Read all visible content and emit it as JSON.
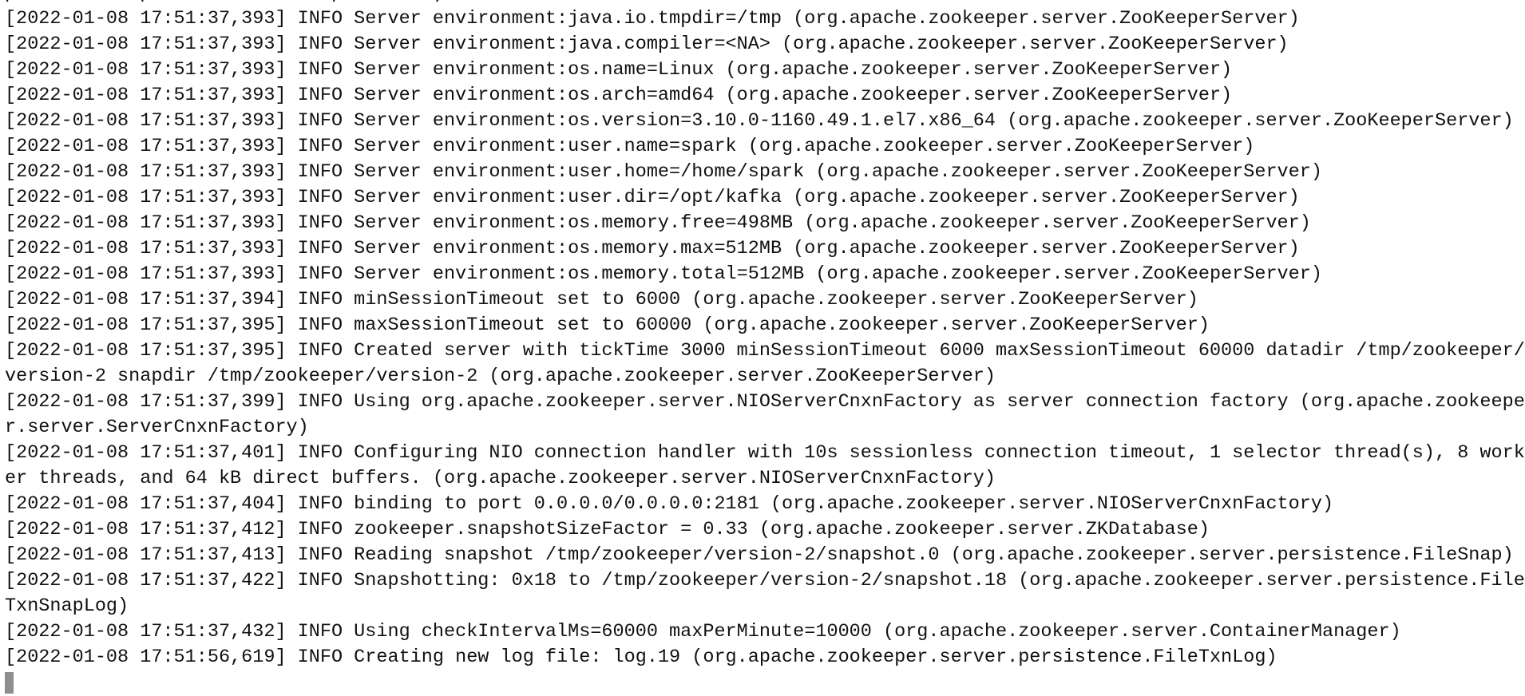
{
  "terminal": {
    "rows": [
      "pache.zookeeper.server.ZooKeeperServer)",
      "[2022-01-08 17:51:37,393] INFO Server environment:java.io.tmpdir=/tmp (org.apache.zookeeper.server.ZooKeeperServer)",
      "[2022-01-08 17:51:37,393] INFO Server environment:java.compiler=<NA> (org.apache.zookeeper.server.ZooKeeperServer)",
      "[2022-01-08 17:51:37,393] INFO Server environment:os.name=Linux (org.apache.zookeeper.server.ZooKeeperServer)",
      "[2022-01-08 17:51:37,393] INFO Server environment:os.arch=amd64 (org.apache.zookeeper.server.ZooKeeperServer)",
      "[2022-01-08 17:51:37,393] INFO Server environment:os.version=3.10.0-1160.49.1.el7.x86_64 (org.apache.zookeeper.server.ZooKeeperServer)",
      "[2022-01-08 17:51:37,393] INFO Server environment:user.name=spark (org.apache.zookeeper.server.ZooKeeperServer)",
      "[2022-01-08 17:51:37,393] INFO Server environment:user.home=/home/spark (org.apache.zookeeper.server.ZooKeeperServer)",
      "[2022-01-08 17:51:37,393] INFO Server environment:user.dir=/opt/kafka (org.apache.zookeeper.server.ZooKeeperServer)",
      "[2022-01-08 17:51:37,393] INFO Server environment:os.memory.free=498MB (org.apache.zookeeper.server.ZooKeeperServer)",
      "[2022-01-08 17:51:37,393] INFO Server environment:os.memory.max=512MB (org.apache.zookeeper.server.ZooKeeperServer)",
      "[2022-01-08 17:51:37,393] INFO Server environment:os.memory.total=512MB (org.apache.zookeeper.server.ZooKeeperServer)",
      "[2022-01-08 17:51:37,394] INFO minSessionTimeout set to 6000 (org.apache.zookeeper.server.ZooKeeperServer)",
      "[2022-01-08 17:51:37,395] INFO maxSessionTimeout set to 60000 (org.apache.zookeeper.server.ZooKeeperServer)",
      "[2022-01-08 17:51:37,395] INFO Created server with tickTime 3000 minSessionTimeout 6000 maxSessionTimeout 60000 datadir /tmp/zookeeper/",
      "version-2 snapdir /tmp/zookeeper/version-2 (org.apache.zookeeper.server.ZooKeeperServer)",
      "[2022-01-08 17:51:37,399] INFO Using org.apache.zookeeper.server.NIOServerCnxnFactory as server connection factory (org.apache.zookeepe",
      "r.server.ServerCnxnFactory)",
      "[2022-01-08 17:51:37,401] INFO Configuring NIO connection handler with 10s sessionless connection timeout, 1 selector thread(s), 8 work",
      "er threads, and 64 kB direct buffers. (org.apache.zookeeper.server.NIOServerCnxnFactory)",
      "[2022-01-08 17:51:37,404] INFO binding to port 0.0.0.0/0.0.0.0:2181 (org.apache.zookeeper.server.NIOServerCnxnFactory)",
      "[2022-01-08 17:51:37,412] INFO zookeeper.snapshotSizeFactor = 0.33 (org.apache.zookeeper.server.ZKDatabase)",
      "[2022-01-08 17:51:37,413] INFO Reading snapshot /tmp/zookeeper/version-2/snapshot.0 (org.apache.zookeeper.server.persistence.FileSnap)",
      "[2022-01-08 17:51:37,422] INFO Snapshotting: 0x18 to /tmp/zookeeper/version-2/snapshot.18 (org.apache.zookeeper.server.persistence.File",
      "TxnSnapLog)",
      "[2022-01-08 17:51:37,432] INFO Using checkIntervalMs=60000 maxPerMinute=10000 (org.apache.zookeeper.server.ContainerManager)",
      "[2022-01-08 17:51:56,619] INFO Creating new log file: log.19 (org.apache.zookeeper.server.persistence.FileTxnLog)"
    ]
  }
}
